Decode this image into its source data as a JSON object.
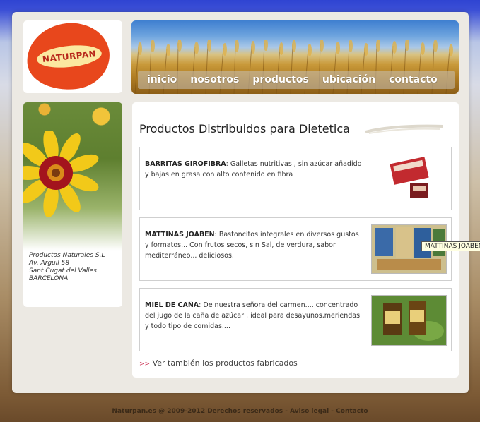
{
  "logo": {
    "text": "NATURPAN",
    "reg": "®"
  },
  "nav": [
    "inicio",
    "nosotros",
    "productos",
    "ubicación",
    "contacto"
  ],
  "address": [
    "Productos Naturales S.L",
    "Av. Argull 58",
    "Sant Cugat del Valles",
    "BARCELONA"
  ],
  "main": {
    "title": "Productos Distribuidos para Dietetica",
    "products": [
      {
        "name": "BARRITAS GIROFIBRA",
        "description": ": Galletas nutritivas , sin azúcar añadido y bajas en grasa con alto contenido en fibra"
      },
      {
        "name": "MATTINAS JOABEN",
        "description": ": Bastoncitos integrales en diversos gustos y formatos... Con frutos secos, sin Sal, de verdura, sabor mediterráneo... deliciosos."
      },
      {
        "name": "MIEL DE CAÑA",
        "description": ": De nuestra señora del carmen.... concentrado del jugo de la caña de azúcar , ideal para desayunos,meriendas y todo tipo de comidas...."
      }
    ],
    "tooltip": "MATTINAS JOABEN",
    "more_arrows": ">>",
    "more_link": "Ver también los productos fabricados"
  },
  "footer": "Naturpan.es @ 2009-2012 Derechos reservados - Aviso legal - Contacto",
  "colors": {
    "logo_orange": "#e8471c",
    "accent_pink": "#cc3355"
  }
}
